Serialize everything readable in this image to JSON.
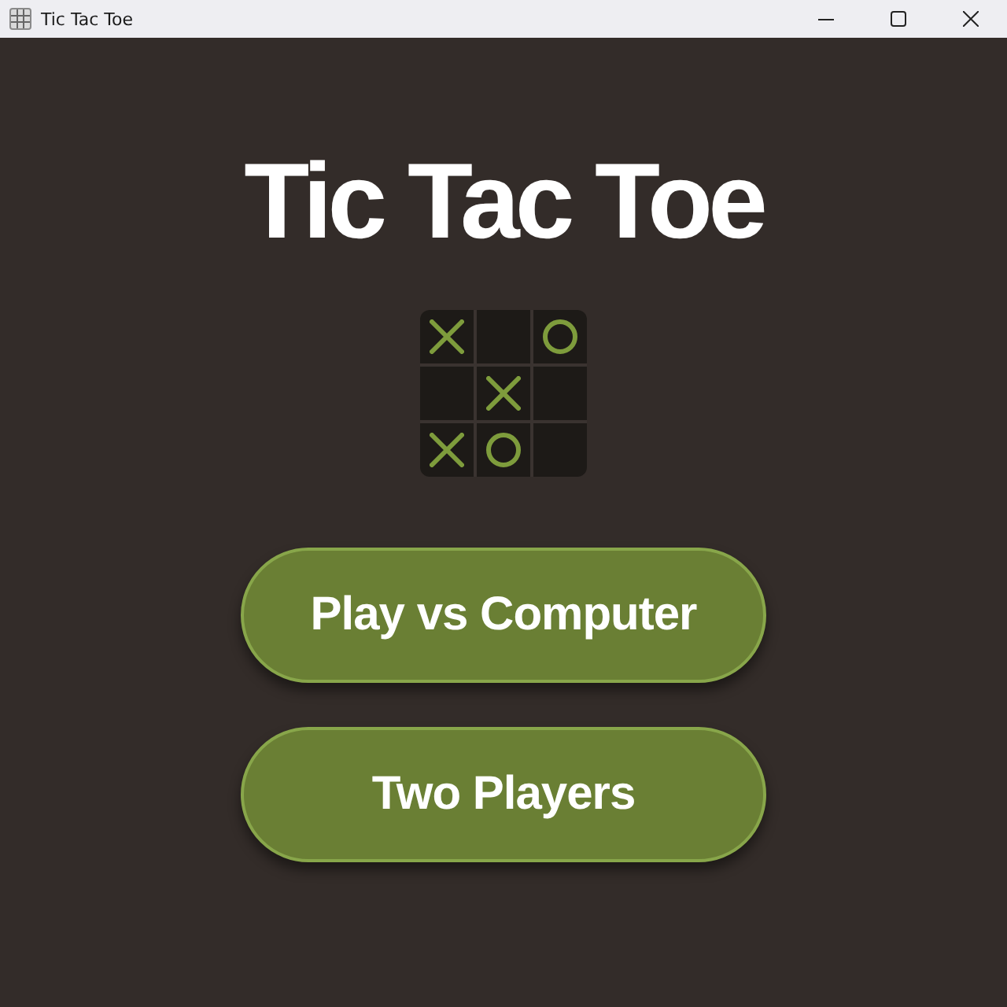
{
  "window": {
    "title": "Tic Tac Toe"
  },
  "title": "Tic Tac Toe",
  "board": {
    "cells": [
      {
        "kind": "x"
      },
      {
        "kind": "empty"
      },
      {
        "kind": "o"
      },
      {
        "kind": "empty"
      },
      {
        "kind": "x"
      },
      {
        "kind": "empty"
      },
      {
        "kind": "x"
      },
      {
        "kind": "o"
      },
      {
        "kind": "empty"
      }
    ]
  },
  "buttons": [
    "Play vs Computer",
    "Two Players"
  ]
}
